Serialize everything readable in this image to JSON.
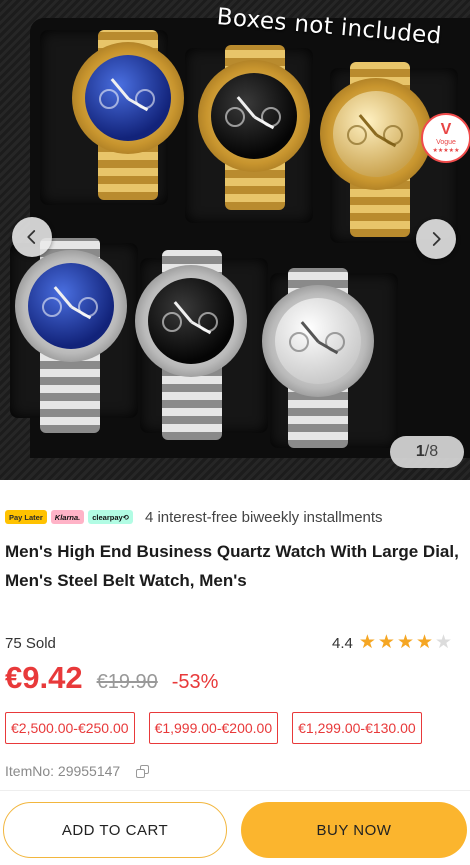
{
  "gallery": {
    "caption": "Boxes not included",
    "counter_current": "1",
    "counter_total": "/8",
    "badge": {
      "line1": "V",
      "line2": "Vogue",
      "line3": "★★★★★"
    },
    "icons": {
      "prev": "chevron-left-icon",
      "next": "chevron-right-icon"
    }
  },
  "payment": {
    "logos": [
      "Pay Later",
      "Klarna.",
      "clearpay⟲"
    ],
    "text": "4 interest-free biweekly installments"
  },
  "product": {
    "title": "Men's High End Business Quartz Watch With Large Dial, Men's Steel Belt Watch, Men's",
    "sold": "75 Sold",
    "rating": "4.4",
    "rating_stars": {
      "value": 4.4,
      "max": 5
    },
    "price": "€9.42",
    "old_price": "€19.90",
    "discount": "-53%",
    "coupons": [
      "€2,500.00-€250.00",
      "€1,999.00-€200.00",
      "€1,299.00-€130.00"
    ],
    "item_no": "ItemNo: 29955147"
  },
  "actions": {
    "add_to_cart": "ADD TO CART",
    "buy_now": "BUY NOW"
  },
  "colors": {
    "price_red": "#e8393a",
    "star": "#f5a623",
    "button_yellow": "#fbb52e"
  }
}
